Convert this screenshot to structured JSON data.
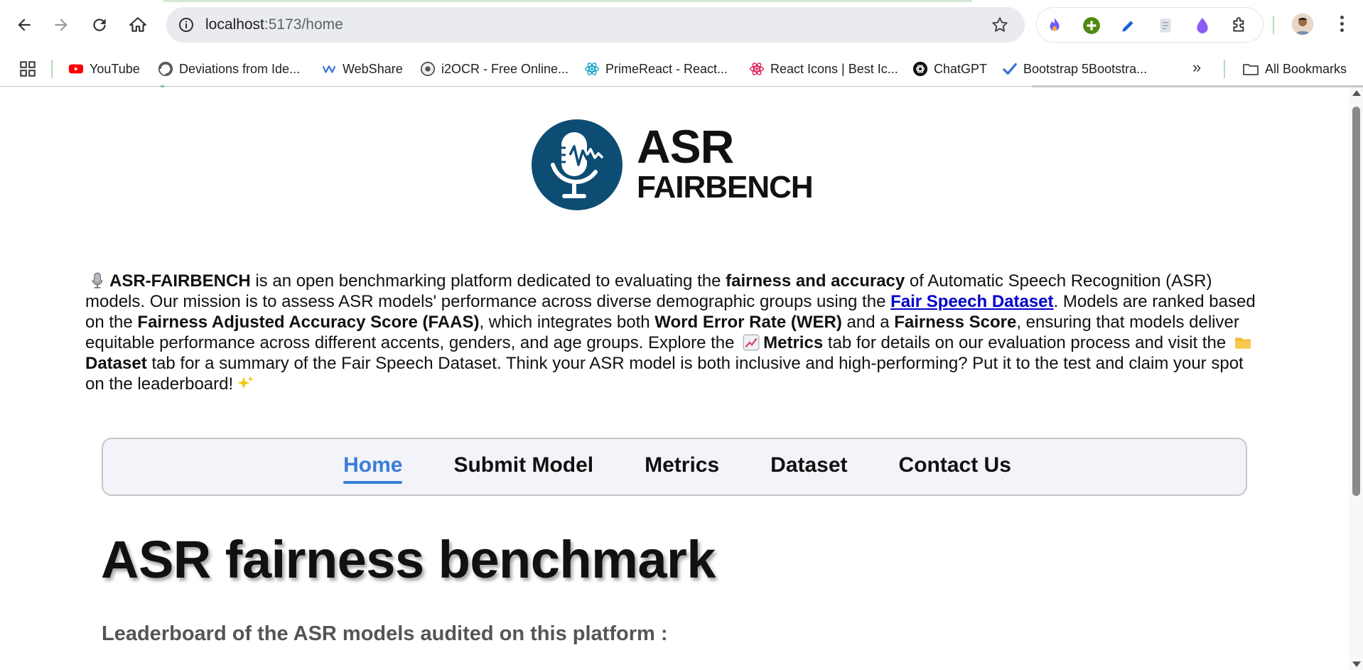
{
  "browser": {
    "url_host": "localhost",
    "url_path": ":5173/home",
    "bookmarks": [
      {
        "label": "YouTube",
        "icon": "youtube-icon"
      },
      {
        "label": "Deviations from Ide...",
        "icon": "swirl-icon"
      },
      {
        "label": "WebShare",
        "icon": "webshare-icon"
      },
      {
        "label": "i2OCR - Free Online...",
        "icon": "i2ocr-icon"
      },
      {
        "label": "PrimeReact - React...",
        "icon": "primereact-icon"
      },
      {
        "label": "React Icons | Best Ic...",
        "icon": "react-icon"
      },
      {
        "label": "ChatGPT",
        "icon": "chatgpt-icon"
      },
      {
        "label": "Bootstrap 5Bootstra...",
        "icon": "checkmark-icon"
      }
    ],
    "more_bookmarks": "»",
    "all_bookmarks": "All Bookmarks"
  },
  "logo": {
    "line1": "ASR",
    "line2": "FAIRBENCH"
  },
  "intro": {
    "p1": "ASR-FAIRBENCH",
    "p2": " is an open benchmarking platform dedicated to evaluating the ",
    "p3": "fairness and accuracy",
    "p4": " of Automatic Speech Recognition (ASR) models. Our mission is to assess ASR models' performance across diverse demographic groups using the ",
    "link": "Fair Speech Dataset",
    "p5": ". Models are ranked based on the ",
    "p6": "Fairness Adjusted Accuracy Score (FAAS)",
    "p7": ", which integrates both ",
    "p8": "Word Error Rate (WER)",
    "p9": " and a ",
    "p10": "Fairness Score",
    "p11": ", ensuring that models deliver equitable performance across different accents, genders, and age groups. Explore the ",
    "p12": "Metrics",
    "p13": " tab for details on our evaluation process and visit the ",
    "p14": "Dataset",
    "p15": " tab for a summary of the Fair Speech Dataset. Think your ASR model is both inclusive and high-performing? Put it to the test and claim your spot on the leaderboard!"
  },
  "nav": {
    "items": [
      {
        "label": "Home",
        "active": true
      },
      {
        "label": "Submit Model"
      },
      {
        "label": "Metrics"
      },
      {
        "label": "Dataset"
      },
      {
        "label": "Contact Us"
      }
    ],
    "active_color": "#3b7dd8"
  },
  "main": {
    "title": "ASR fairness benchmark",
    "subtitle": "Leaderboard of the ASR models audited on this platform :"
  },
  "colors": {
    "logo_blue": "#0e4d73",
    "link": "#0000cc"
  }
}
